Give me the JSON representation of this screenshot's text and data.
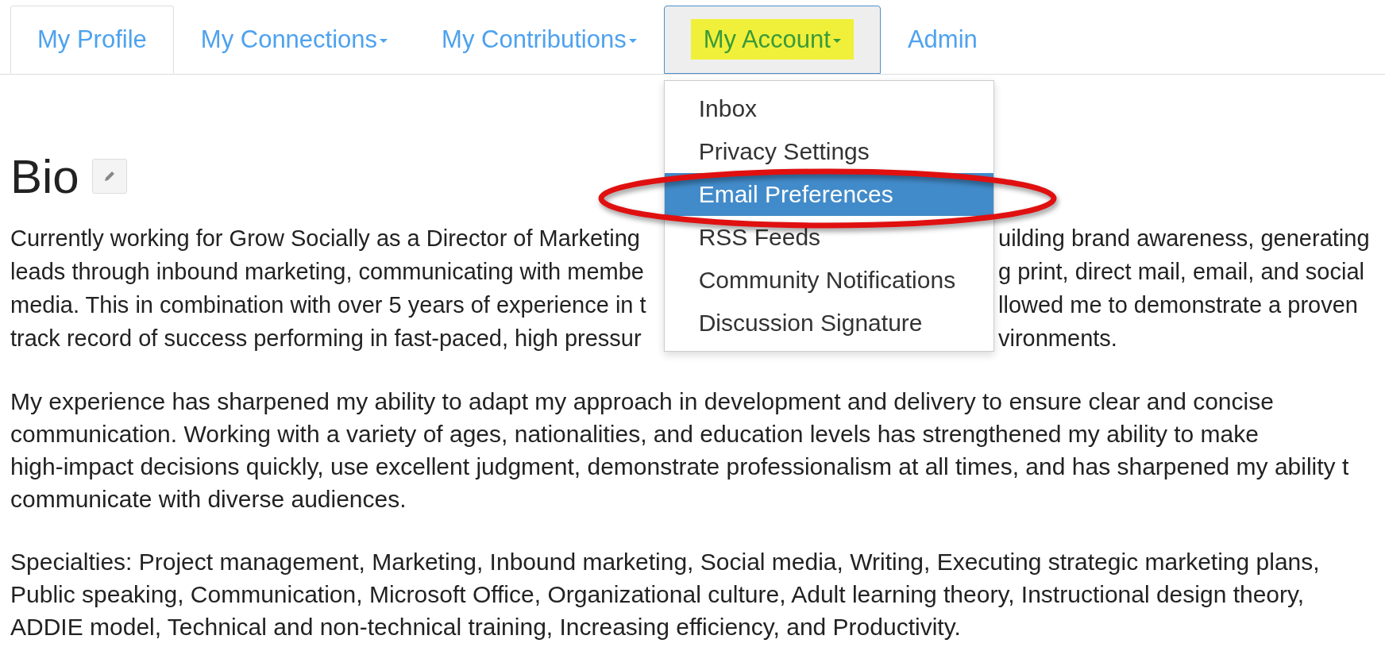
{
  "tabs": [
    {
      "label": "My Profile",
      "selected": true,
      "has_menu": false,
      "open": false,
      "highlighted": false
    },
    {
      "label": "My Connections",
      "selected": false,
      "has_menu": true,
      "open": false,
      "highlighted": false
    },
    {
      "label": "My Contributions",
      "selected": false,
      "has_menu": true,
      "open": false,
      "highlighted": false
    },
    {
      "label": "My Account",
      "selected": false,
      "has_menu": true,
      "open": true,
      "highlighted": true
    },
    {
      "label": "Admin",
      "selected": false,
      "has_menu": false,
      "open": false,
      "highlighted": false
    }
  ],
  "dropdown": {
    "items": [
      {
        "label": "Inbox",
        "selected": false
      },
      {
        "label": "Privacy Settings",
        "selected": false
      },
      {
        "label": "Email Preferences",
        "selected": true
      },
      {
        "label": "RSS Feeds",
        "selected": false
      },
      {
        "label": "Community Notifications",
        "selected": false
      },
      {
        "label": "Discussion Signature",
        "selected": false
      }
    ],
    "annotation": {
      "kind": "ellipse",
      "color": "#e01010"
    }
  },
  "bio": {
    "title": "Bio",
    "covered_paragraph": [
      {
        "left": "Currently working for Grow Socially as a Director of Marketing",
        "right": "uilding brand awareness, generating"
      },
      {
        "left": "leads through inbound marketing, communicating with membe",
        "right": "g print, direct mail, email, and social"
      },
      {
        "left": "media. This in combination with over 5 years of experience in t",
        "right": "llowed me to demonstrate a proven"
      },
      {
        "left": "track record of success performing in fast-paced, high pressur",
        "right": "vironments."
      }
    ],
    "paragraphs": [
      "My experience has sharpened my ability to adapt my approach in development and delivery to ensure clear and concise\ncommunication. Working with a variety of ages, nationalities, and education levels has strengthened my ability to make\nhigh-impact decisions quickly, use excellent judgment, demonstrate professionalism at all times, and has sharpened my ability t\ncommunicate with diverse audiences.",
      "Specialties: Project management, Marketing, Inbound marketing, Social media, Writing, Executing strategic marketing plans,\nPublic speaking, Communication, Microsoft Office, Organizational culture, Adult learning theory, Instructional design theory,\nADDIE model, Technical and non-technical training, Increasing efficiency, and Productivity."
    ]
  }
}
